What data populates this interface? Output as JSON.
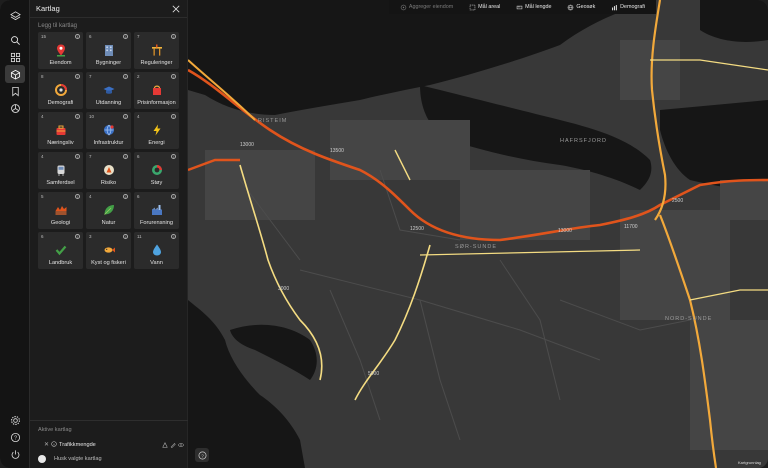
{
  "panel": {
    "title": "Kartlag",
    "subtitle": "Legg til kartlag",
    "tiles": [
      {
        "count": "15",
        "label": "Eiendom",
        "icon": "property-pin-icon"
      },
      {
        "count": "6",
        "label": "Bygninger",
        "icon": "building-icon"
      },
      {
        "count": "7",
        "label": "Reguleringer",
        "icon": "zoning-icon"
      },
      {
        "count": "8",
        "label": "Demografi",
        "icon": "demography-icon"
      },
      {
        "count": "7",
        "label": "Utdanning",
        "icon": "education-icon"
      },
      {
        "count": "2",
        "label": "Prisinformasjon",
        "icon": "price-tag-icon"
      },
      {
        "count": "4",
        "label": "Næringsliv",
        "icon": "business-icon"
      },
      {
        "count": "10",
        "label": "Infrastruktur",
        "icon": "infrastructure-icon"
      },
      {
        "count": "4",
        "label": "Energi",
        "icon": "lightning-icon"
      },
      {
        "count": "4",
        "label": "Samferdsel",
        "icon": "transport-icon"
      },
      {
        "count": "7",
        "label": "Risiko",
        "icon": "risk-icon"
      },
      {
        "count": "6",
        "label": "Støy",
        "icon": "noise-gauge-icon"
      },
      {
        "count": "5",
        "label": "Geologi",
        "icon": "geology-icon"
      },
      {
        "count": "4",
        "label": "Natur",
        "icon": "leaf-icon"
      },
      {
        "count": "6",
        "label": "Forurensning",
        "icon": "factory-icon"
      },
      {
        "count": "6",
        "label": "Landbruk",
        "icon": "check-leaf-icon"
      },
      {
        "count": "3",
        "label": "Kyst og fiskeri",
        "icon": "fish-icon"
      },
      {
        "count": "11",
        "label": "Vann",
        "icon": "water-drop-icon"
      }
    ],
    "active_title": "Aktive kartlag",
    "active_layers": [
      {
        "label": "Trafikkmengde"
      }
    ],
    "remember_label": "Husk valgte kartlag"
  },
  "toolbar": {
    "items": [
      {
        "label": "Aggreger eiendom",
        "icon": "aggregate-icon",
        "enabled": false
      },
      {
        "label": "Mål areal",
        "icon": "measure-area-icon",
        "enabled": true
      },
      {
        "label": "Mål lengde",
        "icon": "measure-length-icon",
        "enabled": true
      },
      {
        "label": "Geosøk",
        "icon": "globe-icon",
        "enabled": true
      },
      {
        "label": "Demografi",
        "icon": "bar-chart-icon",
        "enabled": true
      }
    ]
  },
  "map": {
    "place_labels": [
      "HAFRSFJORD",
      "SØR-SUNDE",
      "NORD-SUNDE",
      "RISTEIM"
    ],
    "traffic_labels": [
      "13000",
      "13500",
      "12500",
      "13000",
      "11700",
      "2500",
      "5000",
      "3000"
    ],
    "attribution": "Kartgrunnlag"
  },
  "colors": {
    "panel_bg": "#1c1c1c",
    "rail_bg": "#141414",
    "tile_bg": "#2b2b2b",
    "water": "#151515",
    "land": "#3a3a3a",
    "road_high": "#e0541c",
    "road_mid": "#f2a93b",
    "road_low": "#f4dc82"
  }
}
